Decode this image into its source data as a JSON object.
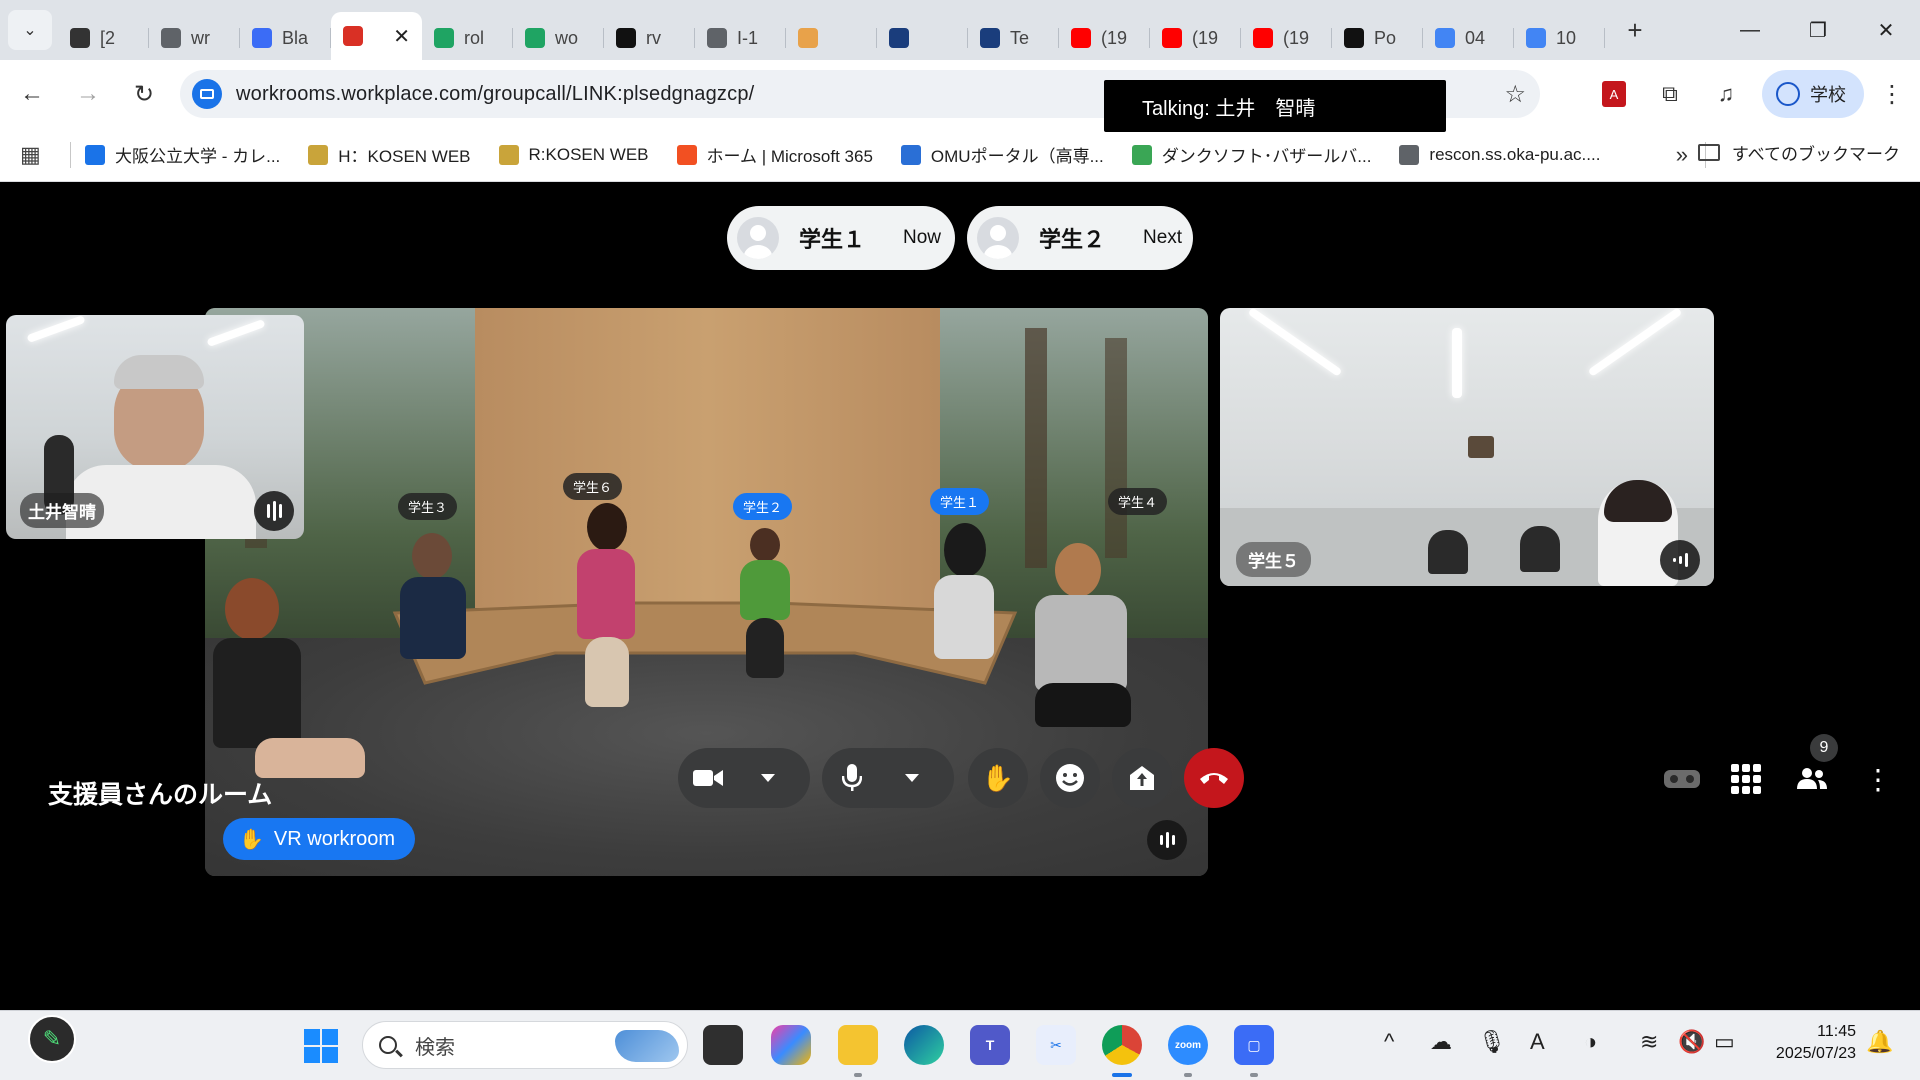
{
  "tabs": [
    {
      "title": "[2",
      "color": "#333333",
      "icon": "document-icon"
    },
    {
      "title": "wr",
      "color": "#5f6368",
      "icon": "globe-icon"
    },
    {
      "title": "Bla",
      "color": "#3b6cf6",
      "icon": "app-icon"
    },
    {
      "title": "",
      "color": "#d93025",
      "icon": "record-icon",
      "active": true
    },
    {
      "title": "rol",
      "color": "#1fa463",
      "icon": "drive-icon"
    },
    {
      "title": "wo",
      "color": "#1fa463",
      "icon": "drive-icon"
    },
    {
      "title": "rv",
      "color": "#111111",
      "icon": "github-icon"
    },
    {
      "title": "I-1",
      "color": "#5f6368",
      "icon": "globe-icon"
    },
    {
      "title": "",
      "color": "#e8a24a",
      "icon": "cat-icon"
    },
    {
      "title": "",
      "color": "#1a3d7c",
      "icon": "tm-icon"
    },
    {
      "title": "Te",
      "color": "#1a3d7c",
      "icon": "tm-icon"
    },
    {
      "title": "(19",
      "color": "#ff0000",
      "icon": "youtube-icon"
    },
    {
      "title": "(19",
      "color": "#ff0000",
      "icon": "youtube-icon"
    },
    {
      "title": "(19",
      "color": "#ff0000",
      "icon": "youtube-icon"
    },
    {
      "title": "Po",
      "color": "#111111",
      "icon": "triangle-icon"
    },
    {
      "title": "04",
      "color": "#4285f4",
      "icon": "google-icon"
    },
    {
      "title": "10",
      "color": "#4285f4",
      "icon": "google-icon"
    }
  ],
  "toolbar": {
    "url": "workrooms.workplace.com/groupcall/LINK:plsedgnagzcp/",
    "talking": "Talking: 土井　智晴",
    "profile_label": "学校"
  },
  "bookmarks": [
    {
      "label": "大阪公立大学 - カレ...",
      "color": "#1a73e8"
    },
    {
      "label": "H：KOSEN WEB",
      "color": "#c9a43a"
    },
    {
      "label": "R:KOSEN WEB",
      "color": "#c9a43a"
    },
    {
      "label": "ホーム | Microsoft 365",
      "color": "#f25022"
    },
    {
      "label": "OMUポータル（高専...",
      "color": "#2a6fd6"
    },
    {
      "label": "ダンクソフト･バザールバ...",
      "color": "#3aa655"
    },
    {
      "label": "rescon.ss.oka-pu.ac....",
      "color": "#5f6368"
    }
  ],
  "bookmarks_all": "すべてのブックマーク",
  "speakers": {
    "now_name": "学生１",
    "now_status": "Now",
    "next_name": "学生２",
    "next_status": "Next"
  },
  "tiles": {
    "self_name": "土井智晴",
    "room_name": "学生５",
    "vr_badge": "VR workroom",
    "vr_tags": [
      "学生３",
      "学生６",
      "学生２",
      "学生１",
      "学生４"
    ]
  },
  "call": {
    "room_title": "支援員さんのルーム",
    "participant_count": "9"
  },
  "taskbar": {
    "search_placeholder": "検索",
    "time": "11:45",
    "date": "2025/07/23"
  }
}
